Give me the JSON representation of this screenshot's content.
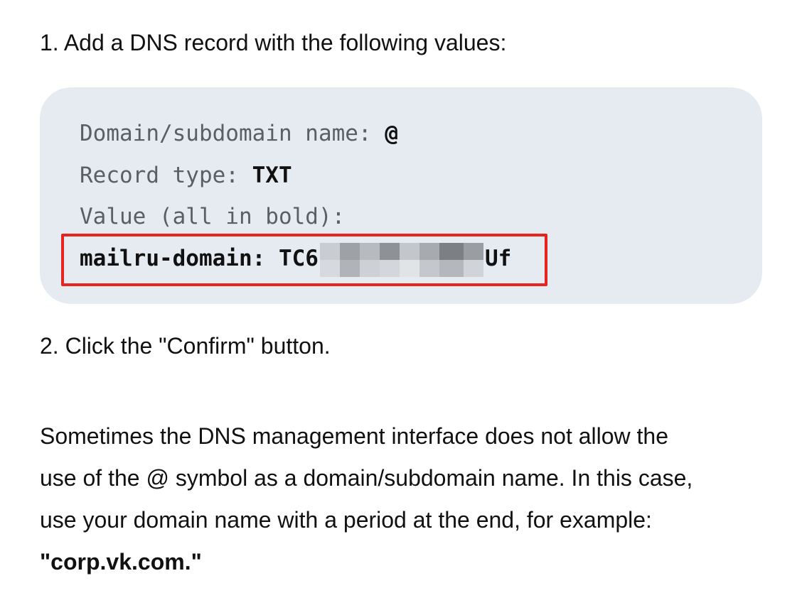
{
  "step1": {
    "text": "1. Add a DNS record with the following values:"
  },
  "code_block": {
    "domain_label": "Domain/subdomain name: ",
    "domain_value": "@",
    "type_label": "Record type: ",
    "type_value": "TXT",
    "value_label": "Value (all in bold):",
    "value_prefix": "mailru-domain: TC6",
    "value_suffix": "Uf",
    "highlight_color": "#e8231f",
    "background_color": "#e6ebf1"
  },
  "step2": {
    "text": "2. Click the \"Confirm\" button."
  },
  "note": {
    "line1": "Sometimes the DNS management interface does not allow the",
    "line2": "use of the @ symbol as a domain/subdomain name. In this case,",
    "line3": "use your domain name with a period at the end, for example:",
    "example": "\"corp.vk.com.\""
  }
}
